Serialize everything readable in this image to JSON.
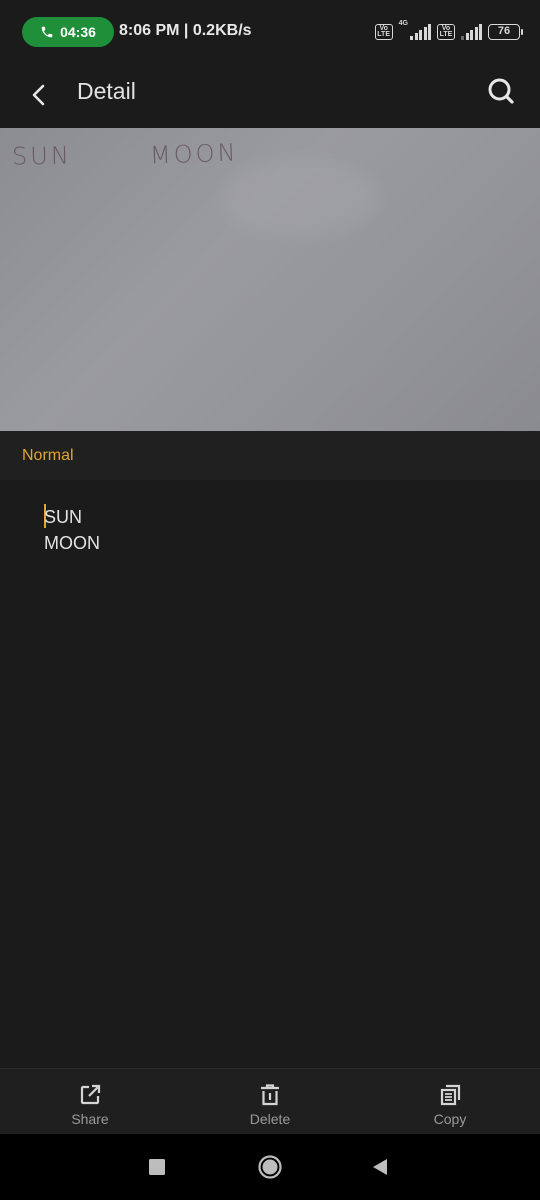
{
  "status_bar": {
    "call_timer": "04:36",
    "time_speed": "8:06 PM | 0.2KB/s",
    "volte_1": "Vo LTE",
    "network_type": "4G",
    "volte_2": "Vo LTE",
    "battery": "76"
  },
  "header": {
    "title": "Detail"
  },
  "preview": {
    "handwritten_word_1": "SUN",
    "handwritten_word_2": "MOON"
  },
  "mode": {
    "label": "Normal"
  },
  "recognized_text": {
    "line_1": "SUN",
    "line_2": "MOON"
  },
  "actions": {
    "share": "Share",
    "delete": "Delete",
    "copy": "Copy"
  },
  "colors": {
    "accent": "#e0a437",
    "call_pill": "#1f8f3a",
    "background": "#1b1b1b"
  },
  "icons": [
    "phone-icon",
    "back-arrow-icon",
    "search-icon",
    "share-icon",
    "delete-icon",
    "copy-icon",
    "recent-apps-icon",
    "home-icon",
    "nav-back-icon"
  ]
}
